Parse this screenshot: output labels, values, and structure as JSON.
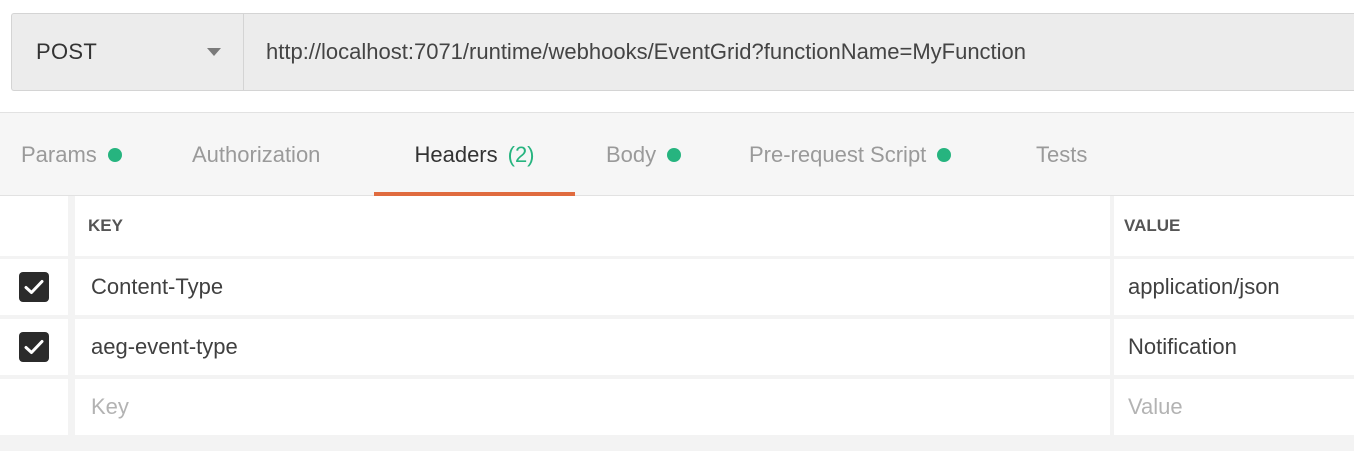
{
  "request": {
    "method": "POST",
    "url": "http://localhost:7071/runtime/webhooks/EventGrid?functionName=MyFunction"
  },
  "tabs": [
    {
      "label": "Params",
      "indicator": true
    },
    {
      "label": "Authorization",
      "indicator": false
    },
    {
      "label": "Headers",
      "count": "(2)",
      "active": true
    },
    {
      "label": "Body",
      "indicator": true
    },
    {
      "label": "Pre-request Script",
      "indicator": true
    },
    {
      "label": "Tests",
      "indicator": false
    }
  ],
  "headers_table": {
    "columns": {
      "key": "KEY",
      "value": "VALUE"
    },
    "rows": [
      {
        "checked": true,
        "key": "Content-Type",
        "value": "application/json"
      },
      {
        "checked": true,
        "key": "aeg-event-type",
        "value": "Notification"
      }
    ],
    "new_row": {
      "key_placeholder": "Key",
      "value_placeholder": "Value"
    }
  },
  "colors": {
    "accent_underline": "#e06b3f",
    "indicator_dot": "#26b47f",
    "count_text": "#26b47f",
    "checkbox_fill": "#2b2b2b"
  }
}
